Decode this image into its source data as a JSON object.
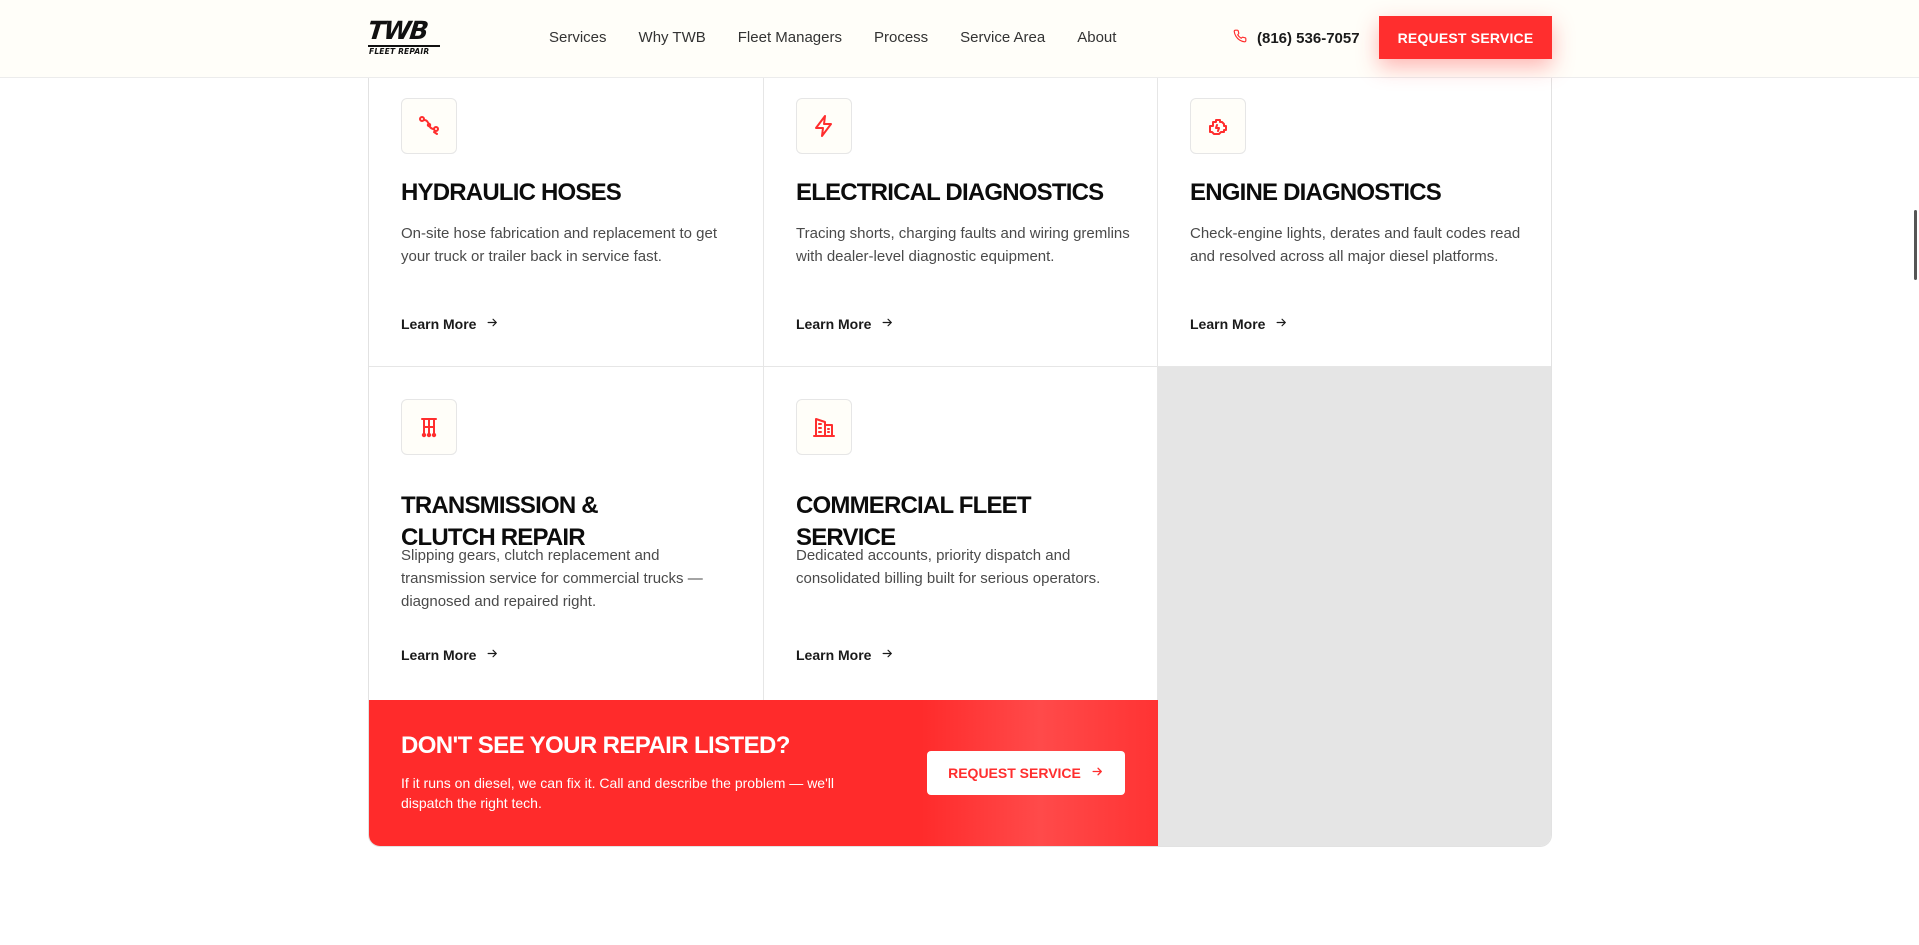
{
  "header": {
    "logo_text": "TWB",
    "logo_sub": "FLEET REPAIR",
    "nav": [
      "Services",
      "Why TWB",
      "Fleet Managers",
      "Process",
      "Service Area",
      "About"
    ],
    "phone": "(816) 536-7057",
    "cta_label": "REQUEST SERVICE"
  },
  "services": [
    {
      "icon": "hydraulic-hose-icon",
      "title": "HYDRAULIC HOSES",
      "description": "On-site hose fabrication and replacement to get your truck or trailer back in service fast.",
      "link": "Learn More"
    },
    {
      "icon": "lightning-bolt-icon",
      "title": "ELECTRICAL DIAGNOSTICS",
      "description": "Tracing shorts, charging faults and wiring gremlins with dealer-level diagnostic equipment.",
      "link": "Learn More"
    },
    {
      "icon": "engine-icon",
      "title": "ENGINE DIAGNOSTICS",
      "description": "Check-engine lights, derates and fault codes read and resolved across all major diesel platforms.",
      "link": "Learn More"
    },
    {
      "icon": "transmission-icon",
      "title": "TRANSMISSION & CLUTCH REPAIR",
      "description": "Slipping gears, clutch replacement and transmission service for commercial trucks — diagnosed and repaired right.",
      "link": "Learn More"
    },
    {
      "icon": "building-icon",
      "title": "COMMERCIAL FLEET SERVICE",
      "description": "Dedicated accounts, priority dispatch and consolidated billing built for serious operators.",
      "link": "Learn More"
    }
  ],
  "cta": {
    "title": "DON'T SEE YOUR REPAIR LISTED?",
    "text": "If it runs on diesel, we can fix it. Call and describe the problem — we'll dispatch the right tech.",
    "button": "REQUEST SERVICE"
  },
  "colors": {
    "accent": "#ff2e2e",
    "background": "#ffffff",
    "header_bg": "#fffef9",
    "placeholder_gray": "#e5e5e5"
  }
}
